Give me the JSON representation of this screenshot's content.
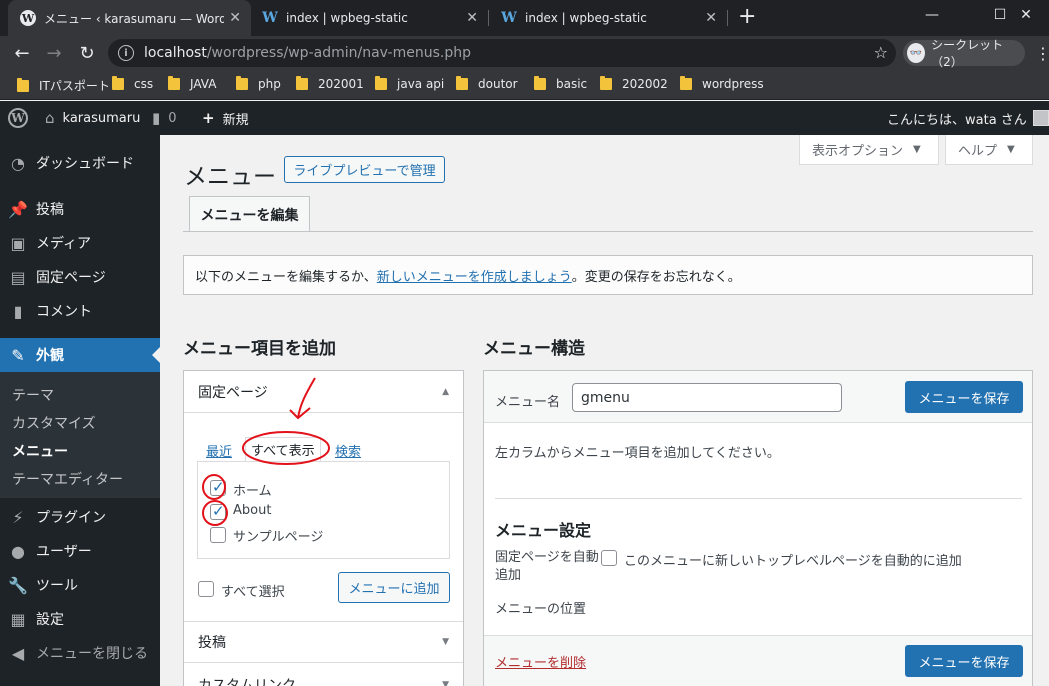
{
  "browser": {
    "tabs": [
      {
        "title": "メニュー ‹ karasumaru — WordPres",
        "active": true
      },
      {
        "title": "index | wpbeg-static",
        "active": false
      },
      {
        "title": "index | wpbeg-static",
        "active": false
      }
    ],
    "url_host": "localhost",
    "url_path": "/wordpress/wp-admin/nav-menus.php",
    "incognito_label": "シークレット（2）",
    "bookmarks": [
      "ITパスポート",
      "css",
      "JAVA",
      "php",
      "202001",
      "java api",
      "doutor",
      "basic",
      "202002",
      "wordpress"
    ]
  },
  "adminbar": {
    "site_name": "karasumaru",
    "comments_count": "0",
    "new_label": "新規",
    "greeting": "こんにちは、wata さん"
  },
  "sidebar": {
    "items": [
      {
        "label": "ダッシュボード",
        "icon": "dashboard-icon"
      },
      {
        "label": "投稿",
        "icon": "pin-icon"
      },
      {
        "label": "メディア",
        "icon": "media-icon"
      },
      {
        "label": "固定ページ",
        "icon": "page-icon"
      },
      {
        "label": "コメント",
        "icon": "comment-icon"
      },
      {
        "label": "外観",
        "icon": "appearance-icon",
        "current": true
      },
      {
        "label": "プラグイン",
        "icon": "plugin-icon"
      },
      {
        "label": "ユーザー",
        "icon": "user-icon"
      },
      {
        "label": "ツール",
        "icon": "wrench-icon"
      },
      {
        "label": "設定",
        "icon": "settings-icon"
      },
      {
        "label": "メニューを閉じる",
        "icon": "collapse-icon"
      }
    ],
    "submenu": [
      "テーマ",
      "カスタマイズ",
      "メニュー",
      "テーマエディター"
    ]
  },
  "main": {
    "screen_options": "表示オプション",
    "help": "ヘルプ",
    "title": "メニュー",
    "live_preview_button": "ライブプレビューで管理",
    "edit_tab": "メニューを編集",
    "notice_prefix": "以下のメニューを編集するか、",
    "notice_link": "新しいメニューを作成しましょう",
    "notice_suffix": "。変更の保存をお忘れなく。",
    "add_items_heading": "メニュー項目を追加",
    "structure_heading": "メニュー構造",
    "pages_panel": {
      "title": "固定ページ",
      "tabs": [
        "最近",
        "すべて表示",
        "検索"
      ],
      "items": [
        {
          "label": "ホーム",
          "checked": true
        },
        {
          "label": "About",
          "checked": true
        },
        {
          "label": "サンプルページ",
          "checked": false
        }
      ],
      "select_all": "すべて選択",
      "add_button": "メニューに追加"
    },
    "posts_panel_title": "投稿",
    "custom_links_title": "カスタムリンク",
    "menu_name_label": "メニュー名",
    "menu_name_value": "gmenu",
    "save_button": "メニューを保存",
    "instructions": "左カラムからメニュー項目を追加してください。",
    "settings_heading": "メニュー設定",
    "auto_add_label": "固定ページを自動追加",
    "auto_add_option": "このメニューに新しいトップレベルページを自動的に追加",
    "location_label": "メニューの位置",
    "delete_link": "メニューを削除"
  }
}
